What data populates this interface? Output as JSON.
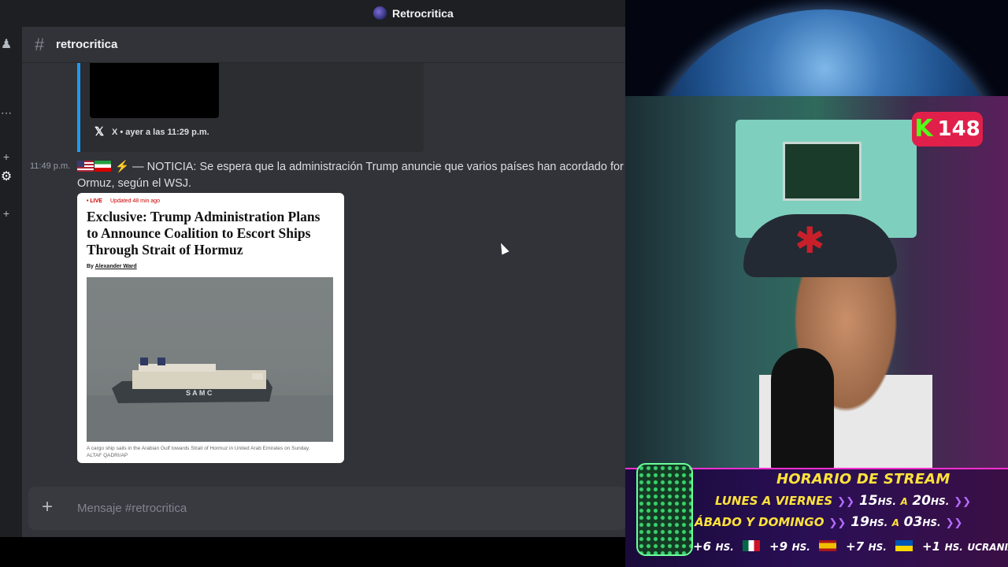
{
  "window": {
    "title": "Retrocritica"
  },
  "channel": {
    "name": "retrocritica"
  },
  "previous_embed": {
    "source_icon": "x-logo-icon",
    "footer": "X • ayer a las 11:29 p.m."
  },
  "message": {
    "timestamp": "11:49 p.m.",
    "line1": "— NOTICIA: Se espera que la administración Trump anuncie que varios países han acordado for",
    "line2": "Ormuz, según el WSJ.",
    "card": {
      "live": "• LIVE",
      "updated": "Updated 48 min ago",
      "headline": "Exclusive: Trump Administration Plans to Announce Coalition to Escort Ships Through Strait of Hormuz",
      "byline_prefix": "By ",
      "author": "Alexander Ward",
      "ship_name": "S A M C",
      "caption": "A cargo ship sails in the Arabian Gulf towards Strait of Hormuz in United Arab Emirates on Sunday.",
      "photo_credit": "ALTAF QADRI/AP"
    }
  },
  "composer": {
    "placeholder": "Mensaje #retrocritica"
  },
  "stream": {
    "viewer_count": "148",
    "platform_icon": "kick-logo-icon",
    "schedule": {
      "title": "HORARIO DE STREAM",
      "rows": [
        {
          "days": "LUNES A VIERNES",
          "from": "15",
          "from_unit": "HS.",
          "sep": "A",
          "to": "20",
          "to_unit": "HS."
        },
        {
          "days": "ÁBADO Y DOMINGO",
          "from": "19",
          "from_unit": "HS.",
          "sep": "A",
          "to": "03",
          "to_unit": "HS."
        }
      ],
      "timezones": [
        {
          "offset": "+6",
          "unit": "HS.",
          "flag": "mexico-flag"
        },
        {
          "offset": "+9",
          "unit": "HS.",
          "flag": "spain-flag"
        },
        {
          "offset": "+7",
          "unit": "HS.",
          "flag": "ukraine-flag"
        },
        {
          "offset": "+1",
          "unit": "HS.",
          "country": "UCRANIA"
        }
      ]
    }
  },
  "colors": {
    "discord_bg": "#313338",
    "embed_accent": "#1d9bf0",
    "kick_green": "#53fc18",
    "kick_badge": "#e0204a",
    "schedule_yellow": "#ffe33a"
  }
}
